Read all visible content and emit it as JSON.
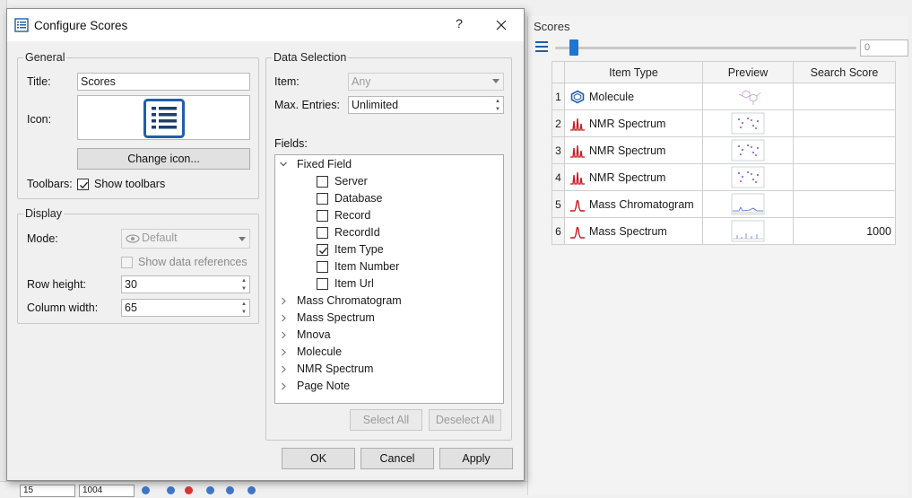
{
  "dialog": {
    "title": "Configure Scores",
    "help_glyph": "?",
    "general": {
      "legend": "General",
      "title_label": "Title:",
      "title_value": "Scores",
      "icon_label": "Icon:",
      "change_icon": "Change icon...",
      "toolbars_label": "Toolbars:",
      "show_toolbars": "Show toolbars",
      "show_toolbars_checked": true
    },
    "display": {
      "legend": "Display",
      "mode_label": "Mode:",
      "mode_value": "Default",
      "show_refs": "Show data references",
      "row_height_label": "Row height:",
      "row_height": "30",
      "col_width_label": "Column width:",
      "col_width": "65"
    },
    "selection": {
      "legend": "Data Selection",
      "item_label": "Item:",
      "item_value": "Any",
      "max_label": "Max. Entries:",
      "max_value": "Unlimited",
      "fields_label": "Fields:",
      "tree": {
        "fixed_field": "Fixed Field",
        "children": [
          {
            "label": "Server",
            "checked": false
          },
          {
            "label": "Database",
            "checked": false
          },
          {
            "label": "Record",
            "checked": false
          },
          {
            "label": "RecordId",
            "checked": false
          },
          {
            "label": "Item Type",
            "checked": true
          },
          {
            "label": "Item Number",
            "checked": false
          },
          {
            "label": "Item Url",
            "checked": false
          }
        ],
        "groups": [
          "Mass Chromatogram",
          "Mass Spectrum",
          "Mnova",
          "Molecule",
          "NMR Spectrum",
          "Page Note"
        ]
      },
      "select_all": "Select All",
      "deselect_all": "Deselect All"
    },
    "buttons": {
      "ok": "OK",
      "cancel": "Cancel",
      "apply": "Apply"
    }
  },
  "panel": {
    "title": "Scores",
    "slider_value": "0",
    "slider_fraction": 0.05,
    "columns": [
      "Item Type",
      "Preview",
      "Search Score"
    ],
    "rows": [
      {
        "num": "1",
        "type": "Molecule",
        "icon": "molecule-icon",
        "score": ""
      },
      {
        "num": "2",
        "type": "NMR Spectrum",
        "icon": "nmr-spectrum-icon",
        "score": ""
      },
      {
        "num": "3",
        "type": "NMR Spectrum",
        "icon": "nmr-spectrum-icon",
        "score": ""
      },
      {
        "num": "4",
        "type": "NMR Spectrum",
        "icon": "nmr-spectrum-icon",
        "score": ""
      },
      {
        "num": "5",
        "type": "Mass Chromatogram",
        "icon": "mass-chromatogram-icon",
        "score": ""
      },
      {
        "num": "6",
        "type": "Mass Spectrum",
        "icon": "mass-spectrum-icon",
        "score": "1000"
      }
    ]
  },
  "bg": {
    "spin_a": "15",
    "spin_b": "1004"
  },
  "colors": {
    "accent": "#1e75d2",
    "icon_blue": "#1f5fa8",
    "spectrum_red": "#c8161d"
  }
}
